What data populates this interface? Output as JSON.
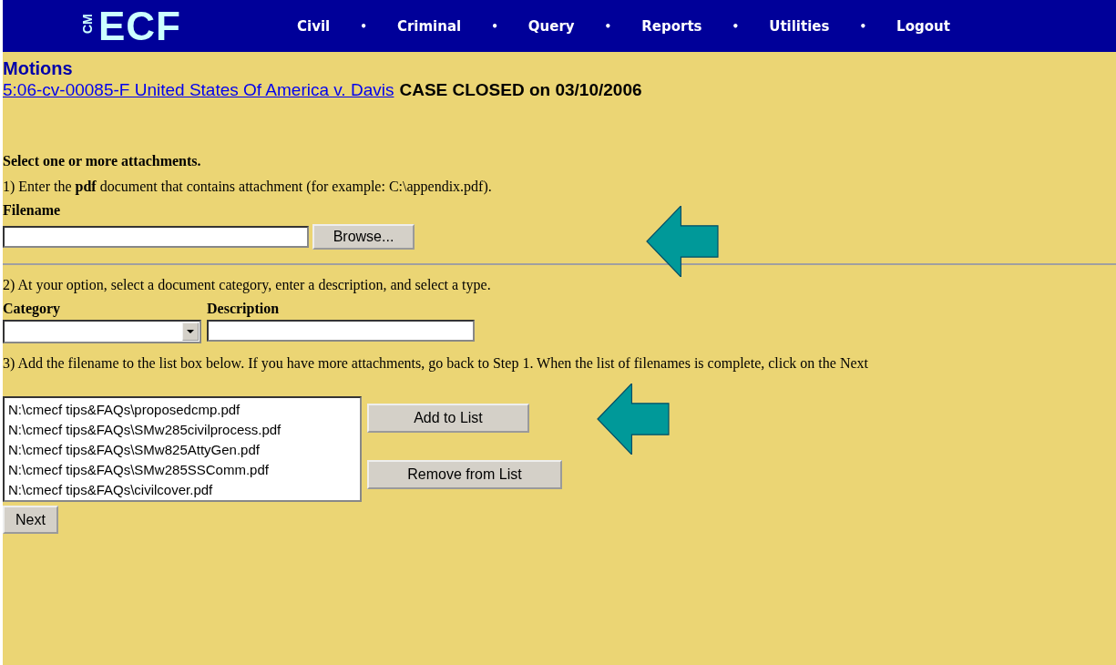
{
  "header": {
    "logo": {
      "small": "CM",
      "large": "ECF"
    },
    "separator": "•",
    "menu": [
      "Civil",
      "Criminal",
      "Query",
      "Reports",
      "Utilities",
      "Logout"
    ]
  },
  "page_title": "Motions",
  "case": {
    "link": "5:06-cv-00085-F United States Of America v. Davis",
    "status": "CASE CLOSED on 03/10/2006"
  },
  "heading": "Select one or more attachments.",
  "step1": {
    "text": "1) Enter the **pdf** document that contains attachment (for example: C:\\appendix.pdf).",
    "label": "Filename",
    "button": "Browse..."
  },
  "step2": {
    "text": "2) At your option, select a document category, enter a description, and select a type.",
    "category_label": "Category",
    "description_label": "Description"
  },
  "step3": {
    "text": "3) Add the filename to the list box below. If you have more attachments, go back to Step 1. When the list of filenames is complete, click on the Next"
  },
  "attachments": [
    "N:\\cmecf tips&FAQs\\proposedcmp.pdf",
    "N:\\cmecf tips&FAQs\\SMw285civilprocess.pdf",
    "N:\\cmecf tips&FAQs\\SMw825AttyGen.pdf",
    "N:\\cmecf tips&FAQs\\SMw285SSComm.pdf",
    "N:\\cmecf tips&FAQs\\civilcover.pdf"
  ],
  "list_buttons": [
    "Add to List",
    "Remove from List"
  ],
  "next_button": "Next"
}
